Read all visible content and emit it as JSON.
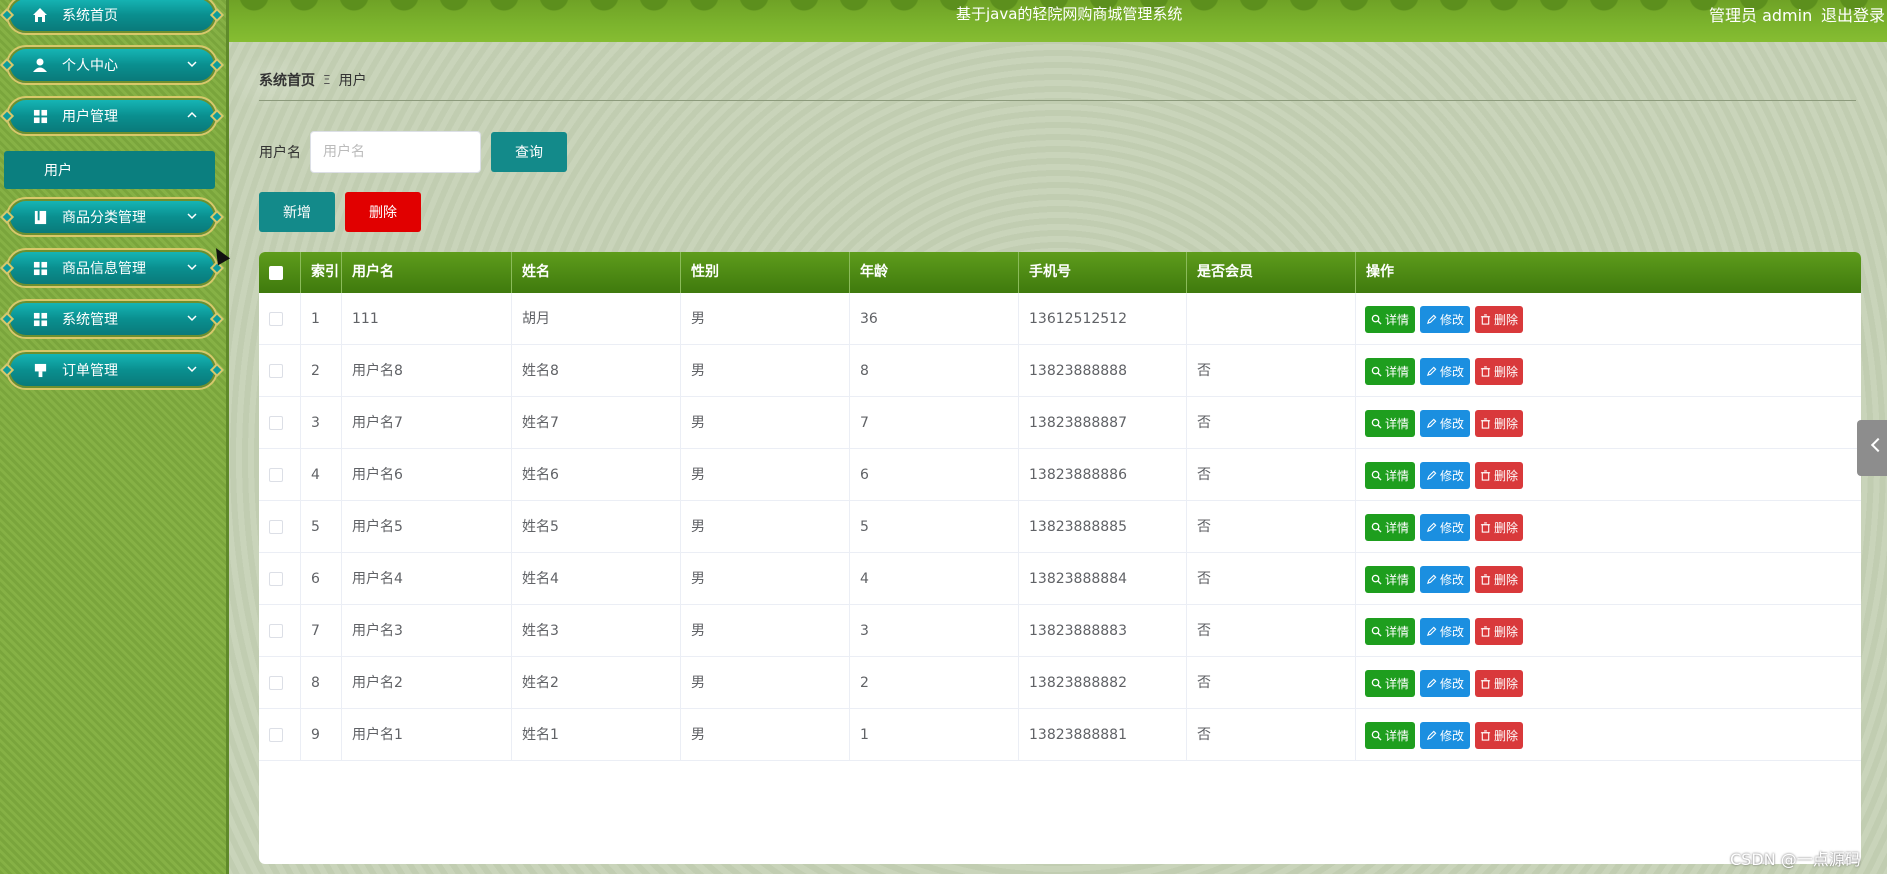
{
  "header": {
    "title": "基于java的轻院网购商城管理系统",
    "user_text": "管理员 admin",
    "logout_label": "退出登录"
  },
  "sidebar": {
    "items": [
      {
        "label": "系统首页",
        "icon": "home-icon"
      },
      {
        "label": "个人中心",
        "icon": "user-icon"
      },
      {
        "label": "用户管理",
        "icon": "grid-icon"
      },
      {
        "label": "商品分类管理",
        "icon": "book-icon"
      },
      {
        "label": "商品信息管理",
        "icon": "grid-icon"
      },
      {
        "label": "系统管理",
        "icon": "grid-icon"
      },
      {
        "label": "订单管理",
        "icon": "stamp-icon"
      }
    ],
    "sub_item": "用户"
  },
  "breadcrumb": {
    "home": "系统首页",
    "separator": "Ξ",
    "current": "用户"
  },
  "search": {
    "label": "用户名",
    "placeholder": "用户名",
    "query_label": "查询"
  },
  "actions": {
    "add_label": "新增",
    "delete_label": "删除"
  },
  "table": {
    "columns": [
      "索引",
      "用户名",
      "姓名",
      "性别",
      "年龄",
      "手机号",
      "是否会员",
      "操作"
    ],
    "row_buttons": {
      "detail": "详情",
      "edit": "修改",
      "remove": "删除"
    },
    "rows": [
      {
        "index": "1",
        "username": "111",
        "name": "胡月",
        "gender": "男",
        "age": "36",
        "phone": "13612512512",
        "member": ""
      },
      {
        "index": "2",
        "username": "用户名8",
        "name": "姓名8",
        "gender": "男",
        "age": "8",
        "phone": "13823888888",
        "member": "否"
      },
      {
        "index": "3",
        "username": "用户名7",
        "name": "姓名7",
        "gender": "男",
        "age": "7",
        "phone": "13823888887",
        "member": "否"
      },
      {
        "index": "4",
        "username": "用户名6",
        "name": "姓名6",
        "gender": "男",
        "age": "6",
        "phone": "13823888886",
        "member": "否"
      },
      {
        "index": "5",
        "username": "用户名5",
        "name": "姓名5",
        "gender": "男",
        "age": "5",
        "phone": "13823888885",
        "member": "否"
      },
      {
        "index": "6",
        "username": "用户名4",
        "name": "姓名4",
        "gender": "男",
        "age": "4",
        "phone": "13823888884",
        "member": "否"
      },
      {
        "index": "7",
        "username": "用户名3",
        "name": "姓名3",
        "gender": "男",
        "age": "3",
        "phone": "13823888883",
        "member": "否"
      },
      {
        "index": "8",
        "username": "用户名2",
        "name": "姓名2",
        "gender": "男",
        "age": "2",
        "phone": "13823888882",
        "member": "否"
      },
      {
        "index": "9",
        "username": "用户名1",
        "name": "姓名1",
        "gender": "男",
        "age": "1",
        "phone": "13823888881",
        "member": "否"
      }
    ]
  },
  "watermark": "CSDN @一点源码",
  "colors": {
    "header": "#7cb42d",
    "nav": "#0a8f8f",
    "table_header": "#4f8c15",
    "detail": "#1e9e1e",
    "edit": "#1b8fe0",
    "remove": "#d9393b",
    "danger": "#e10000"
  }
}
